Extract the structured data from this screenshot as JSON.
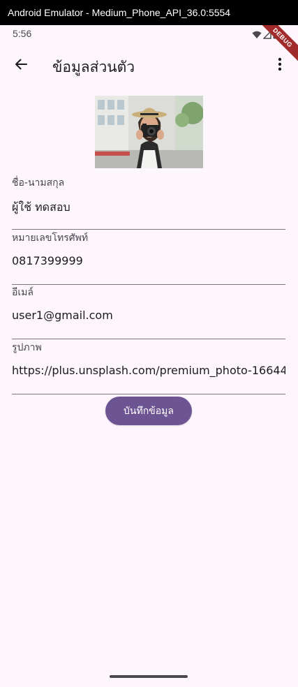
{
  "window": {
    "title": "Android Emulator - Medium_Phone_API_36.0:5554"
  },
  "status_bar": {
    "time": "5:56",
    "icons": [
      "wifi-icon",
      "signal-icon",
      "battery-icon"
    ]
  },
  "debug_banner": "DEBUG",
  "app_bar": {
    "title": "ข้อมูลส่วนตัว",
    "back_icon": "arrow-back-icon",
    "menu_icon": "more-vert-icon"
  },
  "fields": {
    "name": {
      "label": "ชื่อ-นามสกุล",
      "value": "ผู้ใช้ ทดสอบ"
    },
    "phone": {
      "label": "หมายเลขโทรศัพท์",
      "value": "0817399999"
    },
    "email": {
      "label": "อีเมล์",
      "value": "user1@gmail.com"
    },
    "image": {
      "label": "รูปภาพ",
      "value": "https://plus.unsplash.com/premium_photo-16644"
    }
  },
  "save_button": {
    "label": "บันทึกข้อมูล"
  },
  "colors": {
    "background": "#fdf6fc",
    "primary": "#6d5493",
    "divider": "#7a757f",
    "text": "#1d1b20",
    "label": "#49454f"
  }
}
